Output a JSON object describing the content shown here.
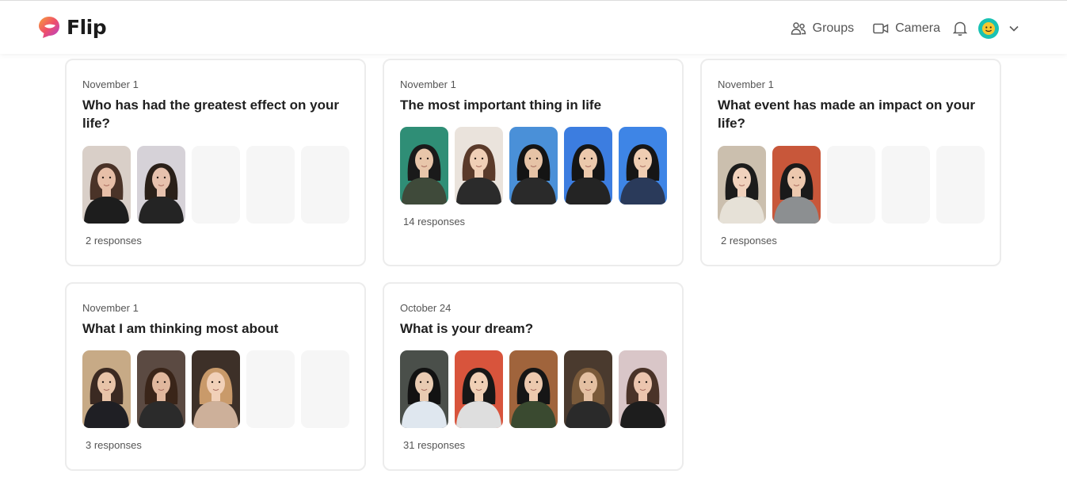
{
  "app": {
    "name": "Flip"
  },
  "nav": {
    "groups": "Groups",
    "camera": "Camera"
  },
  "topics": [
    {
      "date": "November 1",
      "title": "Who has had the greatest effect on your life?",
      "responses": "2 responses",
      "thumbs": [
        {
          "bg": "#d9cfc8",
          "skin": "#e7bfa8",
          "hair": "#4a3328",
          "shirt": "#1d1d1d"
        },
        {
          "bg": "#d6d2d8",
          "skin": "#e6c1ad",
          "hair": "#2a2019",
          "shirt": "#242424"
        },
        null,
        null,
        null
      ]
    },
    {
      "date": "November 1",
      "title": "The most important thing in life",
      "responses": "14 responses",
      "thumbs": [
        {
          "bg": "#2f8e76",
          "skin": "#e8c6aa",
          "hair": "#1a1a1a",
          "shirt": "#3f4a3a"
        },
        {
          "bg": "#eae3dc",
          "skin": "#f0cfb6",
          "hair": "#5a3a2a",
          "shirt": "#2b2b2b"
        },
        {
          "bg": "#4a90d8",
          "skin": "#e6c3a6",
          "hair": "#141414",
          "shirt": "#2a2a2a"
        },
        {
          "bg": "#3c7de0",
          "skin": "#ecc9ac",
          "hair": "#151515",
          "shirt": "#242424"
        },
        {
          "bg": "#3e85e6",
          "skin": "#efcdb2",
          "hair": "#161616",
          "shirt": "#2a3a5a"
        }
      ]
    },
    {
      "date": "November 1",
      "title": "What event has made an impact on your life?",
      "responses": "2 responses",
      "thumbs": [
        {
          "bg": "#cbbfae",
          "skin": "#f1d2bd",
          "hair": "#1c1c1c",
          "shirt": "#e6e1d7"
        },
        {
          "bg": "#c8573a",
          "skin": "#ecc8ae",
          "hair": "#1a1a1a",
          "shirt": "#8c8f91"
        },
        null,
        null,
        null
      ]
    },
    {
      "date": "November 1",
      "title": "What I am thinking most about",
      "responses": "3 responses",
      "thumbs": [
        {
          "bg": "#c7aa86",
          "skin": "#e8c4a8",
          "hair": "#3b2a22",
          "shirt": "#1f1f24"
        },
        {
          "bg": "#5b4a42",
          "skin": "#e0b79d",
          "hair": "#3a2519",
          "shirt": "#2b2b2b"
        },
        {
          "bg": "#3d3028",
          "skin": "#f1d0b8",
          "hair": "#c99a6a",
          "shirt": "#cdb09a"
        },
        null,
        null
      ]
    },
    {
      "date": "October 24",
      "title": "What is your dream?",
      "responses": "31 responses",
      "thumbs": [
        {
          "bg": "#4a4f4a",
          "skin": "#e9cbb2",
          "hair": "#121212",
          "shirt": "#dfe7ef"
        },
        {
          "bg": "#d8543c",
          "skin": "#f0d0b6",
          "hair": "#171717",
          "shirt": "#dedede"
        },
        {
          "bg": "#a0643c",
          "skin": "#ecc9ae",
          "hair": "#161616",
          "shirt": "#3a4a30"
        },
        {
          "bg": "#4a3a2e",
          "skin": "#e4c0a2",
          "hair": "#7a5a3a",
          "shirt": "#2a2a2a"
        },
        {
          "bg": "#d9c6c8",
          "skin": "#ecc5ae",
          "hair": "#4a3328",
          "shirt": "#1d1d1d"
        }
      ]
    }
  ]
}
